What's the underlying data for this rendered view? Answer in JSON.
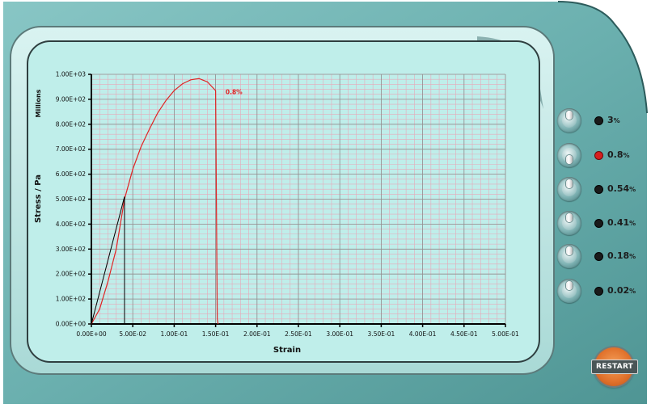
{
  "restart_label": "RESTART",
  "switches": [
    {
      "value": "3",
      "unit": "%",
      "active": false,
      "lever": "up"
    },
    {
      "value": "0.8",
      "unit": "%",
      "active": true,
      "lever": "down"
    },
    {
      "value": "0.54",
      "unit": "%",
      "active": false,
      "lever": "up"
    },
    {
      "value": "0.41",
      "unit": "%",
      "active": false,
      "lever": "up"
    },
    {
      "value": "0.18",
      "unit": "%",
      "active": false,
      "lever": "up"
    },
    {
      "value": "0.02",
      "unit": "%",
      "active": false,
      "lever": "up"
    }
  ],
  "colors": {
    "curve": "#e02424",
    "grid_minor": "#e6a9b9",
    "grid_major": "#8f8f8f",
    "plot_bg": "#bfeeea",
    "active_dot": "#d61f1f"
  },
  "chart_data": {
    "type": "line",
    "xlabel": "Strain",
    "ylabel": "Stress / Pa",
    "y_unit_label": "Millions",
    "xlim": [
      0,
      0.5
    ],
    "ylim": [
      0,
      1000
    ],
    "x_ticks": [
      "0.00E+00",
      "5.00E-02",
      "1.00E-01",
      "1.50E-01",
      "2.00E-01",
      "2.50E-01",
      "3.00E-01",
      "3.50E-01",
      "4.00E-01",
      "4.50E-01",
      "5.00E-01"
    ],
    "y_ticks": [
      "0.00E+00",
      "1.00E+02",
      "2.00E+02",
      "3.00E+02",
      "4.00E+02",
      "5.00E+02",
      "6.00E+02",
      "7.00E+02",
      "8.00E+02",
      "9.00E+02",
      "1.00E+03"
    ],
    "grid": true,
    "series": [
      {
        "name": "0.8%",
        "values": [
          [
            0,
            0
          ],
          [
            0.01,
            60
          ],
          [
            0.02,
            170
          ],
          [
            0.03,
            300
          ],
          [
            0.04,
            500
          ],
          [
            0.05,
            620
          ],
          [
            0.06,
            710
          ],
          [
            0.07,
            780
          ],
          [
            0.08,
            845
          ],
          [
            0.09,
            895
          ],
          [
            0.1,
            935
          ],
          [
            0.11,
            962
          ],
          [
            0.12,
            978
          ],
          [
            0.13,
            983
          ],
          [
            0.14,
            970
          ],
          [
            0.15,
            935
          ],
          [
            0.152,
            20
          ],
          [
            0.153,
            0
          ]
        ]
      },
      {
        "name": "",
        "values": [
          [
            0,
            0
          ],
          [
            0.04,
            510
          ],
          [
            0.04,
            0
          ]
        ]
      }
    ],
    "annotations": [
      {
        "text": "0.8%",
        "x": 0.162,
        "y": 930
      }
    ]
  }
}
